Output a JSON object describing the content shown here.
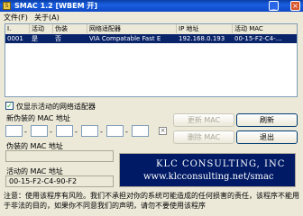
{
  "window": {
    "title": "SMAC 1.2  [WBEM 开]"
  },
  "menu": [
    {
      "label": "文件(F)"
    },
    {
      "label": "关于(A)"
    }
  ],
  "list": {
    "columns": [
      {
        "label": "I."
      },
      {
        "label": "活动"
      },
      {
        "label": "伪装"
      },
      {
        "label": "网络适配器"
      },
      {
        "label": "IP 地址"
      },
      {
        "label": "活动 MAC"
      }
    ],
    "rows": [
      {
        "cells": [
          "0001",
          "是",
          "否",
          "VIA Compatable Fast E",
          "192.168.0.193",
          "00-15-F2-C4-…"
        ]
      }
    ]
  },
  "filter": {
    "label": "仅显示活动的网络适配器",
    "checked": true
  },
  "new_mac": {
    "label": "新伪装的 MAC 地址"
  },
  "spoofed_mac": {
    "label": "伪装的 MAC 地址"
  },
  "active_mac": {
    "label": "活动的 MAC 地址",
    "value": "00-15-F2-C4-90-F2"
  },
  "buttons": {
    "update": "更新 MAC",
    "refresh": "刷新",
    "remove": "删除 MAC",
    "exit": "退出"
  },
  "banner": {
    "line1": "KLC CONSULTING, INC",
    "line2": "www.klcconsulting.net/smac"
  },
  "warning": "注意：使用该程序有风险。我们不承担对你的系统可能造成的任何损害的责任，该程序不能用于非法的目的，如果你不同意我们的声明，请勿不要使用该程序"
}
